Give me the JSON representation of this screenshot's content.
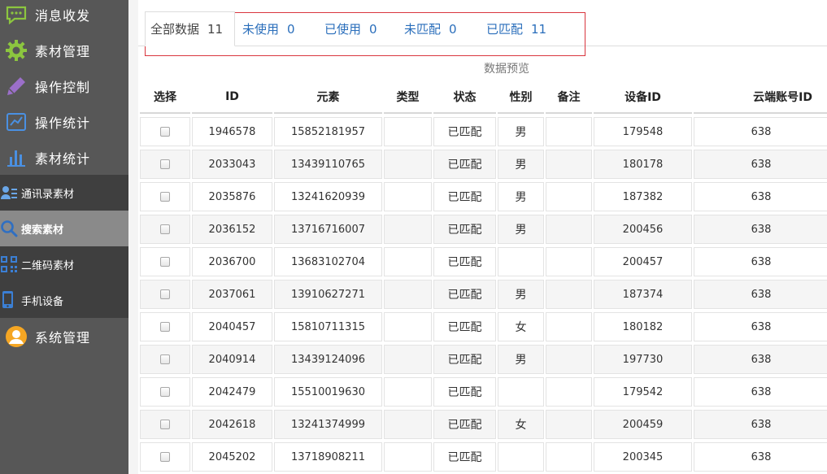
{
  "sidebar": {
    "items": [
      {
        "label": "消息收发",
        "icon": "chat-bubble-icon",
        "color": "#8cc63f"
      },
      {
        "label": "素材管理",
        "icon": "gear-icon",
        "color": "#8cc63f"
      },
      {
        "label": "操作控制",
        "icon": "pencil-icon",
        "color": "#9b6fc9"
      },
      {
        "label": "操作统计",
        "icon": "line-chart-icon",
        "color": "#4a90e2"
      },
      {
        "label": "素材统计",
        "icon": "bar-chart-icon",
        "color": "#4a90e2"
      }
    ],
    "sub_items": [
      {
        "label": "通讯录素材",
        "icon": "contacts-icon"
      },
      {
        "label": "搜索素材",
        "icon": "search-icon",
        "active": true
      },
      {
        "label": "二维码素材",
        "icon": "qr-code-icon"
      },
      {
        "label": "手机设备",
        "icon": "phone-icon"
      }
    ],
    "bottom_item": {
      "label": "系统管理",
      "icon": "user-icon",
      "color": "#f5a623"
    }
  },
  "tabs": [
    {
      "label": "全部数据",
      "count": "11",
      "active": true
    },
    {
      "label": "未使用",
      "count": "0"
    },
    {
      "label": "已使用",
      "count": "0"
    },
    {
      "label": "未匹配",
      "count": "0"
    },
    {
      "label": "已匹配",
      "count": "11"
    }
  ],
  "preview_title": "数据预览",
  "table": {
    "columns": [
      "选择",
      "ID",
      "元素",
      "类型",
      "状态",
      "性别",
      "备注",
      "设备ID",
      "云端账号ID"
    ],
    "rows": [
      {
        "id": "1946578",
        "element": "15852181957",
        "type": "",
        "status": "已匹配",
        "gender": "男",
        "note": "",
        "device_id": "179548",
        "cloud_id": "638"
      },
      {
        "id": "2033043",
        "element": "13439110765",
        "type": "",
        "status": "已匹配",
        "gender": "男",
        "note": "",
        "device_id": "180178",
        "cloud_id": "638"
      },
      {
        "id": "2035876",
        "element": "13241620939",
        "type": "",
        "status": "已匹配",
        "gender": "男",
        "note": "",
        "device_id": "187382",
        "cloud_id": "638"
      },
      {
        "id": "2036152",
        "element": "13716716007",
        "type": "",
        "status": "已匹配",
        "gender": "男",
        "note": "",
        "device_id": "200456",
        "cloud_id": "638"
      },
      {
        "id": "2036700",
        "element": "13683102704",
        "type": "",
        "status": "已匹配",
        "gender": "",
        "note": "",
        "device_id": "200457",
        "cloud_id": "638"
      },
      {
        "id": "2037061",
        "element": "13910627271",
        "type": "",
        "status": "已匹配",
        "gender": "男",
        "note": "",
        "device_id": "187374",
        "cloud_id": "638"
      },
      {
        "id": "2040457",
        "element": "15810711315",
        "type": "",
        "status": "已匹配",
        "gender": "女",
        "note": "",
        "device_id": "180182",
        "cloud_id": "638"
      },
      {
        "id": "2040914",
        "element": "13439124096",
        "type": "",
        "status": "已匹配",
        "gender": "男",
        "note": "",
        "device_id": "197730",
        "cloud_id": "638"
      },
      {
        "id": "2042479",
        "element": "15510019630",
        "type": "",
        "status": "已匹配",
        "gender": "",
        "note": "",
        "device_id": "179542",
        "cloud_id": "638"
      },
      {
        "id": "2042618",
        "element": "13241374999",
        "type": "",
        "status": "已匹配",
        "gender": "女",
        "note": "",
        "device_id": "200459",
        "cloud_id": "638"
      },
      {
        "id": "2045202",
        "element": "13718908211",
        "type": "",
        "status": "已匹配",
        "gender": "",
        "note": "",
        "device_id": "200345",
        "cloud_id": "638"
      }
    ]
  }
}
